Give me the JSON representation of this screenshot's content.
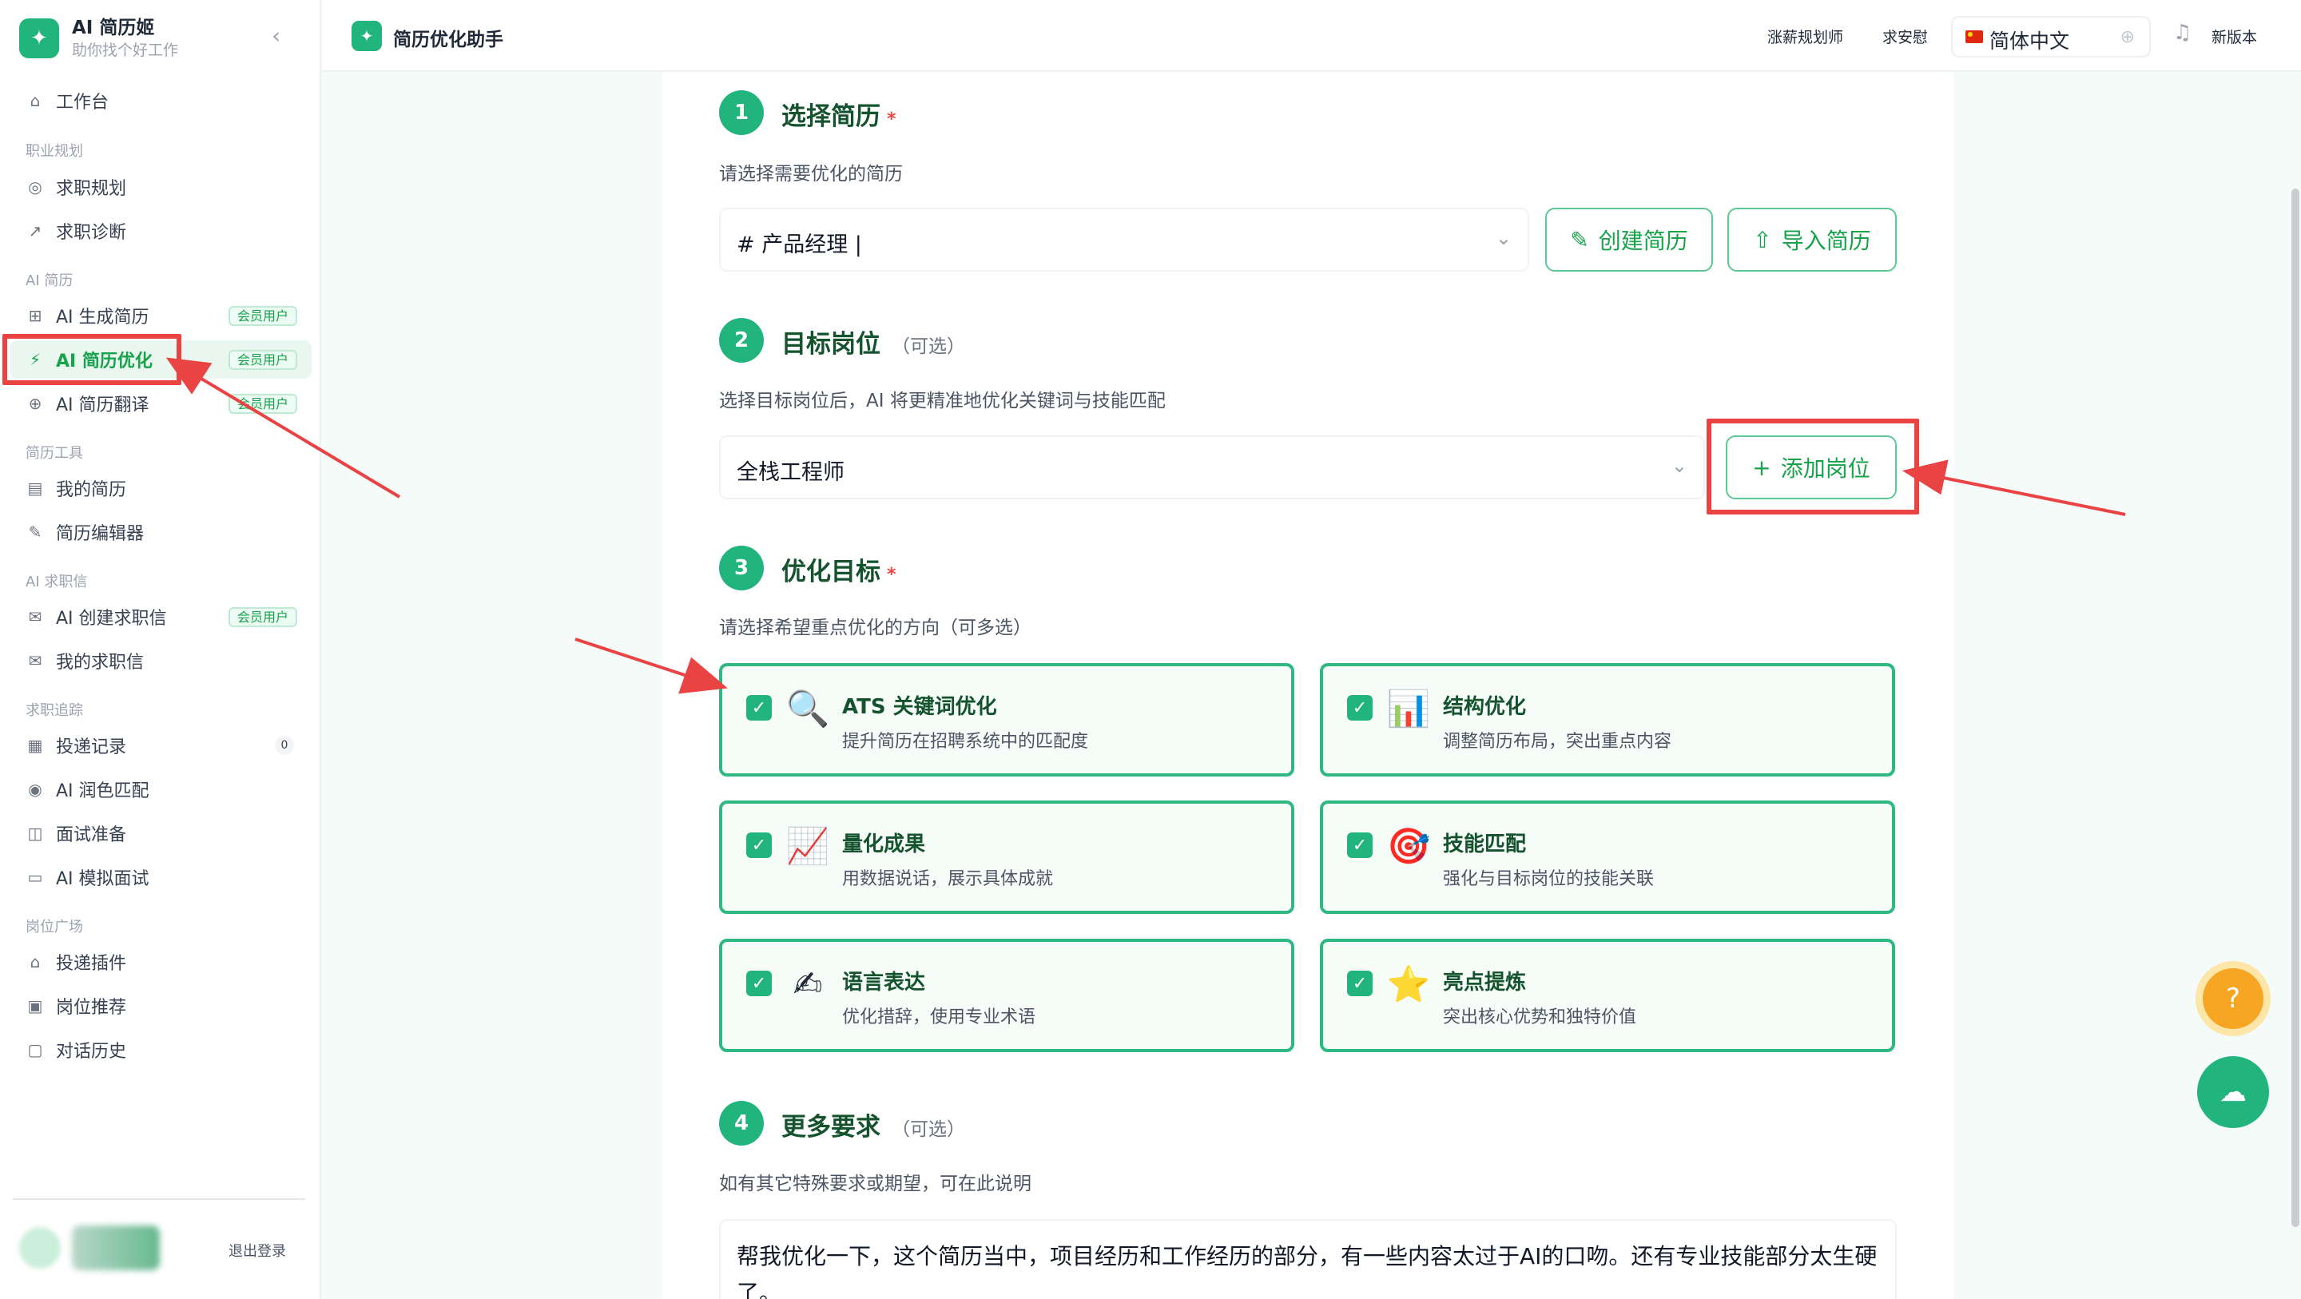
{
  "brand": {
    "title": "AI 简历姬",
    "subtitle": "助你找个好工作"
  },
  "sidebar": {
    "items": [
      {
        "label": "工作台",
        "icon": "home-icon"
      },
      {
        "group": "职业规划"
      },
      {
        "label": "求职规划",
        "icon": "compass-icon"
      },
      {
        "label": "求职诊断",
        "icon": "trend-icon"
      },
      {
        "group": "AI 简历"
      },
      {
        "label": "AI 生成简历",
        "icon": "file-plus-icon",
        "badge": "会员用户"
      },
      {
        "label": "AI 简历优化",
        "icon": "magic-wand-icon",
        "badge": "会员用户",
        "active": true
      },
      {
        "label": "AI 简历翻译",
        "icon": "globe-icon",
        "badge": "会员用户"
      },
      {
        "group": "简历工具"
      },
      {
        "label": "我的简历",
        "icon": "document-icon"
      },
      {
        "label": "简历编辑器",
        "icon": "pen-icon"
      },
      {
        "group": "AI 求职信"
      },
      {
        "label": "AI 创建求职信",
        "icon": "mail-icon",
        "badge": "会员用户"
      },
      {
        "label": "我的求职信",
        "icon": "mail-icon"
      },
      {
        "group": "求职追踪"
      },
      {
        "label": "投递记录",
        "icon": "clipboard-icon",
        "count": "0"
      },
      {
        "label": "AI 润色匹配",
        "icon": "target-icon"
      },
      {
        "label": "面试准备",
        "icon": "book-icon"
      },
      {
        "label": "AI 模拟面试",
        "icon": "video-icon"
      },
      {
        "group": "岗位广场"
      },
      {
        "label": "投递插件",
        "icon": "graduation-cap-icon"
      },
      {
        "label": "岗位推荐",
        "icon": "briefcase-icon"
      },
      {
        "label": "对话历史",
        "icon": "chat-icon"
      }
    ],
    "logout": "退出登录"
  },
  "topbar": {
    "title": "简历优化助手",
    "link1": "涨薪规划师",
    "link2": "求安慰",
    "language": "简体中文",
    "new_version": "新版本"
  },
  "steps": {
    "s1": {
      "num": "1",
      "title": "选择简历",
      "required": "*",
      "hint": "请选择需要优化的简历",
      "value": "# 产品经理 |",
      "create": "创建简历",
      "import": "导入简历"
    },
    "s2": {
      "num": "2",
      "title": "目标岗位",
      "optional": "（可选）",
      "hint": "选择目标岗位后，AI 将更精准地优化关键词与技能匹配",
      "value": "全栈工程师",
      "add": "添加岗位"
    },
    "s3": {
      "num": "3",
      "title": "优化目标",
      "required": "*",
      "hint": "请选择希望重点优化的方向（可多选）"
    },
    "s4": {
      "num": "4",
      "title": "更多要求",
      "optional": "（可选）",
      "hint": "如有其它特殊要求或期望，可在此说明",
      "text": "帮我优化一下，这个简历当中，项目经历和工作经历的部分，有一些内容太过于AI的口吻。还有专业技能部分太生硬了。"
    }
  },
  "goals": [
    {
      "title": "ATS 关键词优化",
      "desc": "提升简历在招聘系统中的匹配度",
      "icon": "magnifier-icon",
      "glyph": "🔍"
    },
    {
      "title": "结构优化",
      "desc": "调整简历布局，突出重点内容",
      "icon": "bar-chart-icon",
      "glyph": "📊"
    },
    {
      "title": "量化成果",
      "desc": "用数据说话，展示具体成就",
      "icon": "line-chart-icon",
      "glyph": "📈"
    },
    {
      "title": "技能匹配",
      "desc": "强化与目标岗位的技能关联",
      "icon": "target-dart-icon",
      "glyph": "🎯"
    },
    {
      "title": "语言表达",
      "desc": "优化措辞，使用专业术语",
      "icon": "writing-hand-icon",
      "glyph": "✍"
    },
    {
      "title": "亮点提炼",
      "desc": "突出核心优势和独特价值",
      "icon": "star-icon",
      "glyph": "⭐"
    }
  ],
  "colors": {
    "accent": "#22b47d",
    "annotation": "#ea4343"
  }
}
